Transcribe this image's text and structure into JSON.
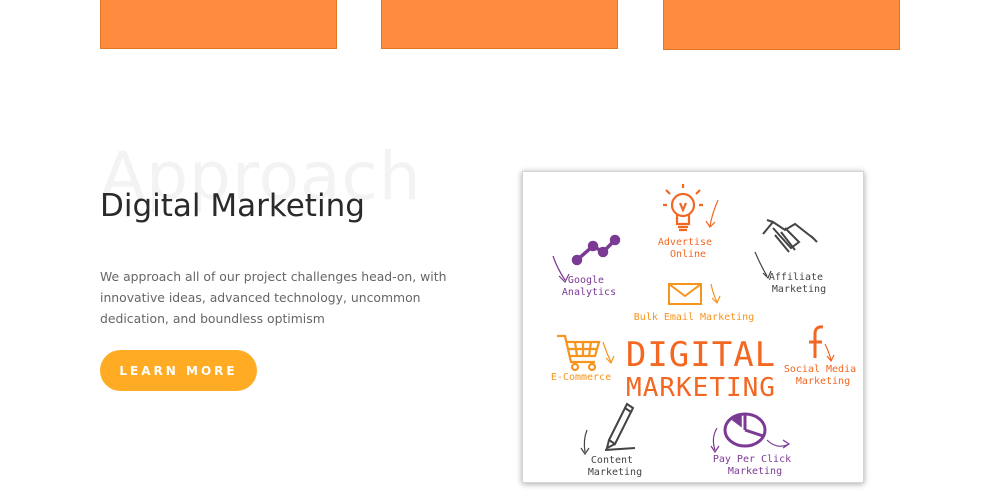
{
  "section": {
    "watermark": "Approach",
    "title": "Digital Marketing",
    "description": "We approach all of our project challenges head-on, with innovative ideas, advanced technology, uncommon dedication, and boundless optimism",
    "button_label": "LEARN MORE"
  },
  "illustration": {
    "main_line1": "DIGITAL",
    "main_line2": "MARKETING",
    "items": {
      "advertise": [
        "Advertise",
        "Online"
      ],
      "affiliate": [
        "Affiliate",
        "Marketing"
      ],
      "google": [
        "Google",
        "Analytics"
      ],
      "email": "Bulk Email Marketing",
      "ecommerce": "E-Commerce",
      "social": [
        "Social Media",
        "Marketing"
      ],
      "content": [
        "Content",
        "Marketing"
      ],
      "ppc": [
        "Pay Per Click",
        "Marketing"
      ]
    }
  },
  "colors": {
    "accent_orange": "#ff8c3e",
    "button": "#ffab24",
    "illustration_orange": "#f26722",
    "illustration_purple": "#7b3a93",
    "illustration_dark": "#444444"
  }
}
